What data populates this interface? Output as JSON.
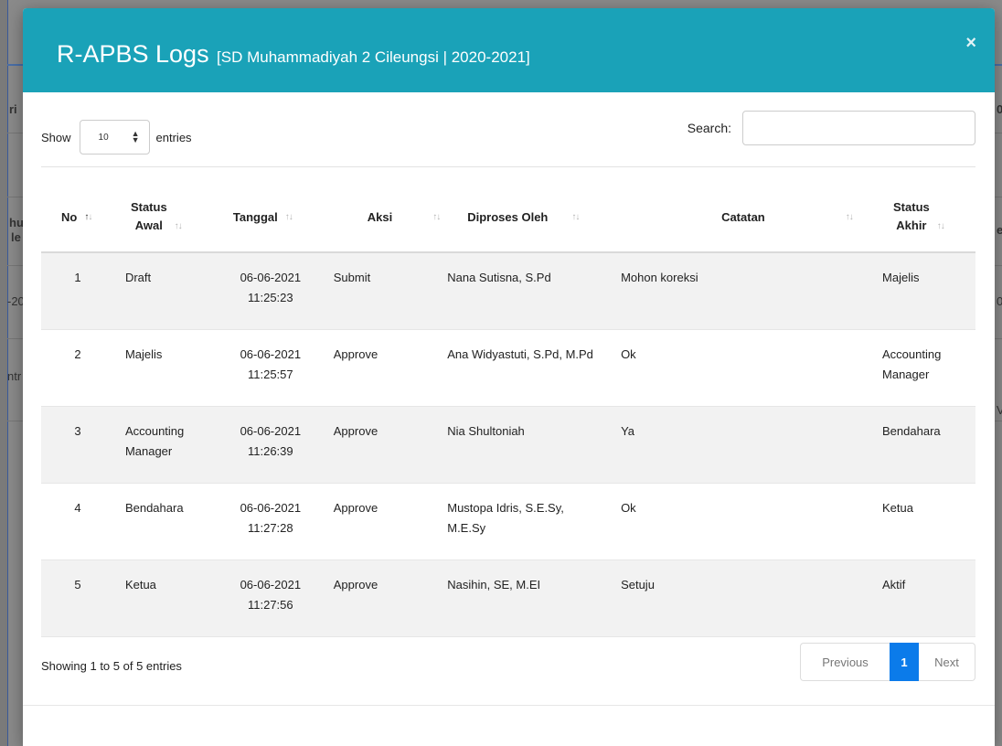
{
  "modal": {
    "title": "R-APBS Logs",
    "subtitle": "[SD Muhammadiyah 2 Cileungsi | 2020-2021]",
    "close_label": "×"
  },
  "controls": {
    "show_label": "Show",
    "entries_label": "entries",
    "page_size": "10",
    "search_label": "Search:",
    "search_value": ""
  },
  "table": {
    "headers": {
      "no": "No",
      "status_awal_1": "Status",
      "status_awal_2": "Awal",
      "tanggal": "Tanggal",
      "aksi": "Aksi",
      "diproses_oleh": "Diproses Oleh",
      "catatan": "Catatan",
      "status_akhir_1": "Status",
      "status_akhir_2": "Akhir"
    },
    "rows": [
      {
        "no": "1",
        "status_awal": "Draft",
        "tanggal_date": "06-06-2021",
        "tanggal_time": "11:25:23",
        "aksi": "Submit",
        "diproses_oleh": "Nana Sutisna, S.Pd",
        "catatan": "Mohon koreksi",
        "status_akhir": "Majelis"
      },
      {
        "no": "2",
        "status_awal": "Majelis",
        "tanggal_date": "06-06-2021",
        "tanggal_time": "11:25:57",
        "aksi": "Approve",
        "diproses_oleh": "Ana Widyastuti, S.Pd, M.Pd",
        "catatan": "Ok",
        "status_akhir": "Accounting Manager"
      },
      {
        "no": "3",
        "status_awal": "Accounting Manager",
        "tanggal_date": "06-06-2021",
        "tanggal_time": "11:26:39",
        "aksi": "Approve",
        "diproses_oleh": "Nia Shultoniah",
        "catatan": "Ya",
        "status_akhir": "Bendahara"
      },
      {
        "no": "4",
        "status_awal": "Bendahara",
        "tanggal_date": "06-06-2021",
        "tanggal_time": "11:27:28",
        "aksi": "Approve",
        "diproses_oleh": "Mustopa Idris, S.E.Sy, M.E.Sy",
        "catatan": "Ok",
        "status_akhir": "Ketua"
      },
      {
        "no": "5",
        "status_awal": "Ketua",
        "tanggal_date": "06-06-2021",
        "tanggal_time": "11:27:56",
        "aksi": "Approve",
        "diproses_oleh": "Nasihin, SE, M.EI",
        "catatan": "Setuju",
        "status_akhir": "Aktif"
      }
    ]
  },
  "footer": {
    "info": "Showing 1 to 5 of 5 entries",
    "prev": "Previous",
    "current": "1",
    "next": "Next"
  },
  "colors": {
    "header_bg": "#1aa2b8",
    "page_active": "#0b7bea"
  },
  "background_fragments": [
    "ri",
    "hu",
    "le",
    "-20",
    "ntr",
    "02",
    "e",
    "0",
    "V"
  ]
}
